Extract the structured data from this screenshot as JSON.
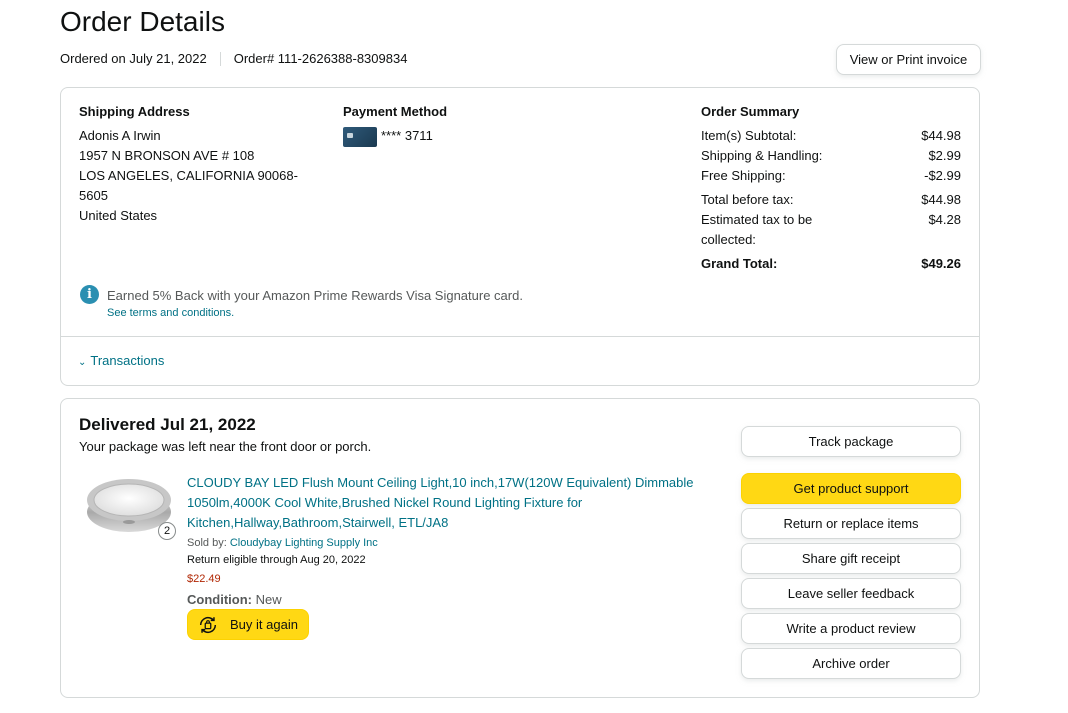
{
  "page": {
    "title": "Order Details",
    "ordered_on": "Ordered on July 21, 2022",
    "order_number": "Order# 111-2626388-8309834",
    "invoice_button": "View or Print invoice"
  },
  "shipping": {
    "heading": "Shipping Address",
    "lines": [
      "Adonis A Irwin",
      "1957 N BRONSON AVE # 108",
      "LOS ANGELES, CALIFORNIA 90068-",
      "5605",
      "United States"
    ]
  },
  "payment": {
    "heading": "Payment Method",
    "card_masked": "**** 3711",
    "card_icon": "credit-card-icon"
  },
  "summary": {
    "heading": "Order Summary",
    "rows": [
      {
        "label": "Item(s) Subtotal:",
        "value": "$44.98"
      },
      {
        "label": "Shipping & Handling:",
        "value": "$2.99"
      },
      {
        "label": "Free Shipping:",
        "value": "-$2.99"
      },
      {
        "label": "Total before tax:",
        "value": "$44.98"
      },
      {
        "label": "Estimated tax to be collected:",
        "value": "$4.28"
      },
      {
        "label": "Grand Total:",
        "value": "$49.26"
      }
    ]
  },
  "rewards": {
    "text": "Earned 5% Back with your Amazon Prime Rewards Visa Signature card.",
    "terms_link": "See terms and conditions."
  },
  "transactions": {
    "label": "Transactions"
  },
  "shipment": {
    "heading": "Delivered Jul 21, 2022",
    "subtext": "Your package was left near the front door or porch.",
    "item": {
      "title": "CLOUDY BAY LED Flush Mount Ceiling Light,10 inch,17W(120W Equivalent) Dimmable 1050lm,4000K Cool White,Brushed Nickel Round Lighting Fixture for Kitchen,Hallway,Bathroom,Stairwell, ETL/JA8",
      "quantity": "2",
      "sold_by_label": "Sold by:",
      "seller": "Cloudybay Lighting Supply Inc",
      "return_eligibility": "Return eligible through Aug 20, 2022",
      "price": "$22.49",
      "condition_label": "Condition:",
      "condition_value": "New",
      "buy_again": "Buy it again"
    },
    "actions": {
      "track": "Track package",
      "support": "Get product support",
      "return": "Return or replace items",
      "gift": "Share gift receipt",
      "feedback": "Leave seller feedback",
      "review": "Write a product review",
      "archive": "Archive order"
    }
  },
  "colors": {
    "link": "#007185",
    "price": "#b12704",
    "primary_button": "#ffd814",
    "border": "#d5d9d9",
    "info_icon": "#2a8fb1"
  }
}
